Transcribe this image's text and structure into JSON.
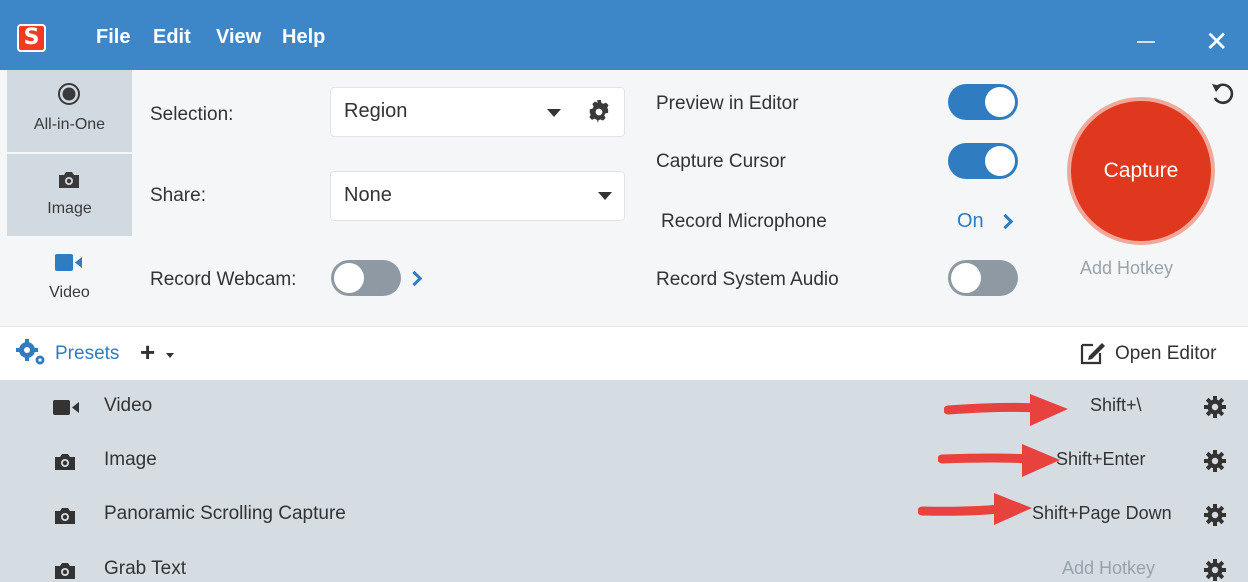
{
  "app": {
    "logo_letter": "S",
    "menu": [
      "File",
      "Edit",
      "View",
      "Help"
    ]
  },
  "tabs": [
    {
      "label": "All-in-One",
      "icon": "radio-dot-icon"
    },
    {
      "label": "Image",
      "icon": "camera-icon"
    },
    {
      "label": "Video",
      "icon": "video-camera-icon",
      "active": true
    }
  ],
  "settings": {
    "selection_label": "Selection:",
    "selection_value": "Region",
    "share_label": "Share:",
    "share_value": "None",
    "webcam_label": "Record Webcam:",
    "webcam_on": false,
    "preview_label": "Preview in Editor",
    "preview_on": true,
    "cursor_label": "Capture Cursor",
    "cursor_on": true,
    "microphone_label": "Record Microphone",
    "microphone_value": "On",
    "system_audio_label": "Record System Audio",
    "system_audio_on": false
  },
  "capture": {
    "button_label": "Capture",
    "add_hotkey": "Add Hotkey"
  },
  "presets": {
    "label": "Presets",
    "add": "+",
    "open_editor": "Open Editor",
    "items": [
      {
        "name": "Video",
        "hotkey": "Shift+\\",
        "icon": "video-camera-icon"
      },
      {
        "name": "Image",
        "hotkey": "Shift+Enter",
        "icon": "camera-icon"
      },
      {
        "name": "Panoramic Scrolling Capture",
        "hotkey": "Shift+Page Down",
        "icon": "camera-icon"
      },
      {
        "name": "Grab Text",
        "hotkey": "Add Hotkey",
        "icon": "camera-icon",
        "muted": true
      }
    ]
  },
  "colors": {
    "titlebar": "#3d87c8",
    "accent": "#2f7cc0",
    "capture": "#e0381e",
    "arrow": "#e8423f"
  }
}
